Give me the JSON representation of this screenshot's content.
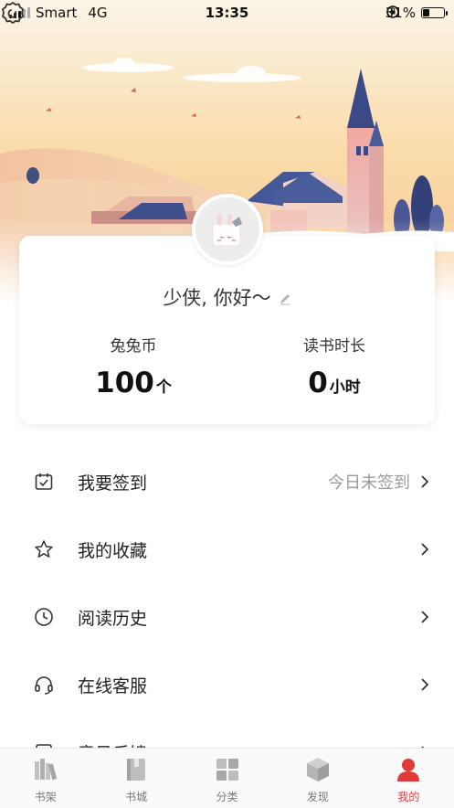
{
  "status_bar": {
    "carrier": "Smart",
    "network": "4G",
    "time": "13:35",
    "battery_percent": "31%",
    "battery_level": 0.31
  },
  "profile": {
    "greeting": "少侠, 你好～",
    "stats": [
      {
        "label": "兔兔币",
        "value": "100",
        "unit": "个"
      },
      {
        "label": "读书时长",
        "value": "0",
        "unit": "小时"
      }
    ]
  },
  "menu": [
    {
      "label": "我要签到",
      "extra": "今日未签到",
      "icon": "calendar-check-icon"
    },
    {
      "label": "我的收藏",
      "extra": "",
      "icon": "star-icon"
    },
    {
      "label": "阅读历史",
      "extra": "",
      "icon": "clock-icon"
    },
    {
      "label": "在线客服",
      "extra": "",
      "icon": "headset-icon"
    },
    {
      "label": "意见反馈",
      "extra": "",
      "icon": "feedback-icon"
    }
  ],
  "tabs": [
    {
      "label": "书架",
      "icon": "bookshelf-icon",
      "active": false
    },
    {
      "label": "书城",
      "icon": "book-icon",
      "active": false
    },
    {
      "label": "分类",
      "icon": "grid-icon",
      "active": false
    },
    {
      "label": "发现",
      "icon": "cube-icon",
      "active": false
    },
    {
      "label": "我的",
      "icon": "user-icon",
      "active": true
    }
  ],
  "colors": {
    "accent": "#e03a3a",
    "tab_inactive": "#b8b8b8",
    "muted_text": "#9a9a9a"
  }
}
